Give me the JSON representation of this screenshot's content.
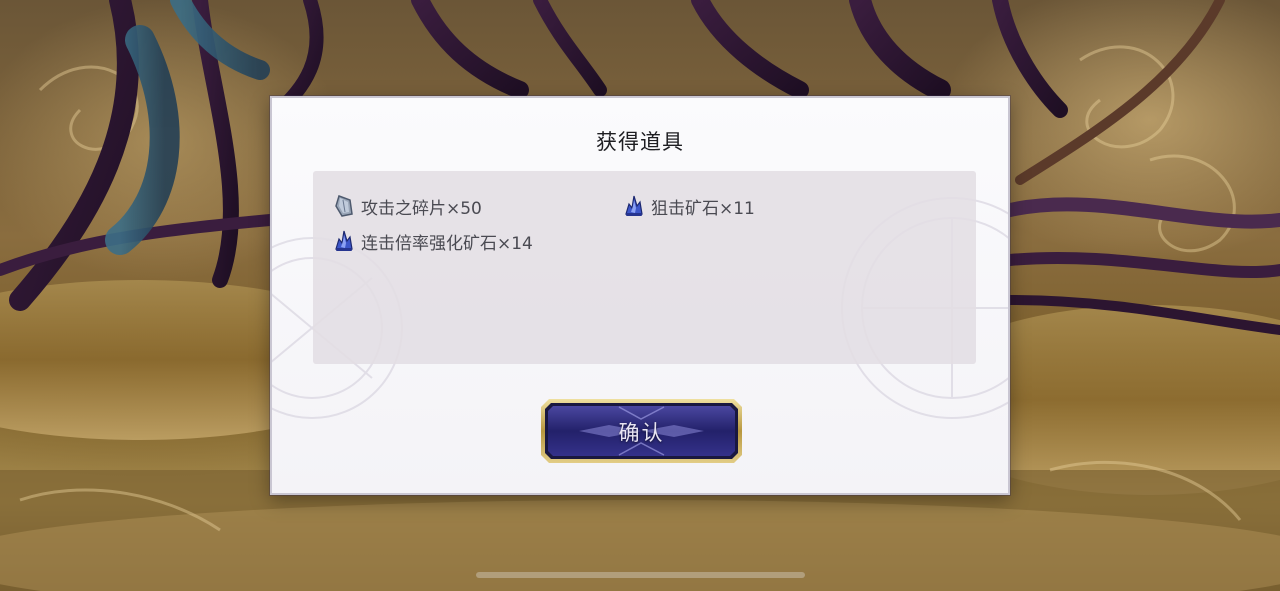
{
  "dialog": {
    "title": "获得道具",
    "items": [
      {
        "label": "攻击之碎片×50",
        "icon": "attack-shard-icon"
      },
      {
        "label": "狙击矿石×11",
        "icon": "snipe-ore-icon"
      },
      {
        "label": "连击倍率强化矿石×14",
        "icon": "combo-ore-icon"
      }
    ],
    "confirm_label": "确认"
  },
  "colors": {
    "panel_bg": "#e2dee4",
    "button_face": "#2b2a6e",
    "button_border": "#c9b36a"
  }
}
